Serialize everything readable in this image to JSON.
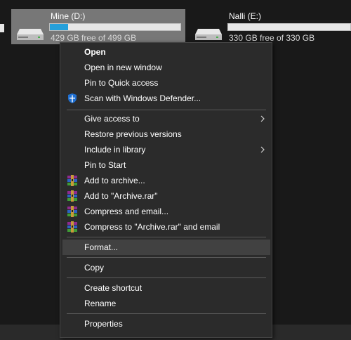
{
  "drives": [
    {
      "name": "Mine (D:)",
      "free_text": "429 GB free of 499 GB",
      "used_fraction": 0.14,
      "selected": true
    },
    {
      "name": "Nalli (E:)",
      "free_text": "330 GB free of 330 GB",
      "used_fraction": 0.0,
      "selected": false
    }
  ],
  "menu": {
    "open": "Open",
    "open_new_window": "Open in new window",
    "pin_quick_access": "Pin to Quick access",
    "scan_defender": "Scan with Windows Defender...",
    "give_access": "Give access to",
    "restore_versions": "Restore previous versions",
    "include_library": "Include in library",
    "pin_start": "Pin to Start",
    "add_archive": "Add to archive...",
    "add_archive_rar": "Add to \"Archive.rar\"",
    "compress_email": "Compress and email...",
    "compress_rar_email": "Compress to \"Archive.rar\" and email",
    "format": "Format...",
    "copy": "Copy",
    "create_shortcut": "Create shortcut",
    "rename": "Rename",
    "properties": "Properties"
  },
  "colors": {
    "background": "#191919",
    "menu_bg": "#2b2b2b",
    "menu_hover": "#414141",
    "drive_selected": "#777777",
    "capacity_fill": "#26a0da",
    "defender_blue": "#1f6fd1"
  },
  "icons": {
    "drive": "hard-drive-icon",
    "defender": "windows-defender-shield-icon",
    "winrar": "winrar-books-icon",
    "submenu": "chevron-right-icon"
  }
}
